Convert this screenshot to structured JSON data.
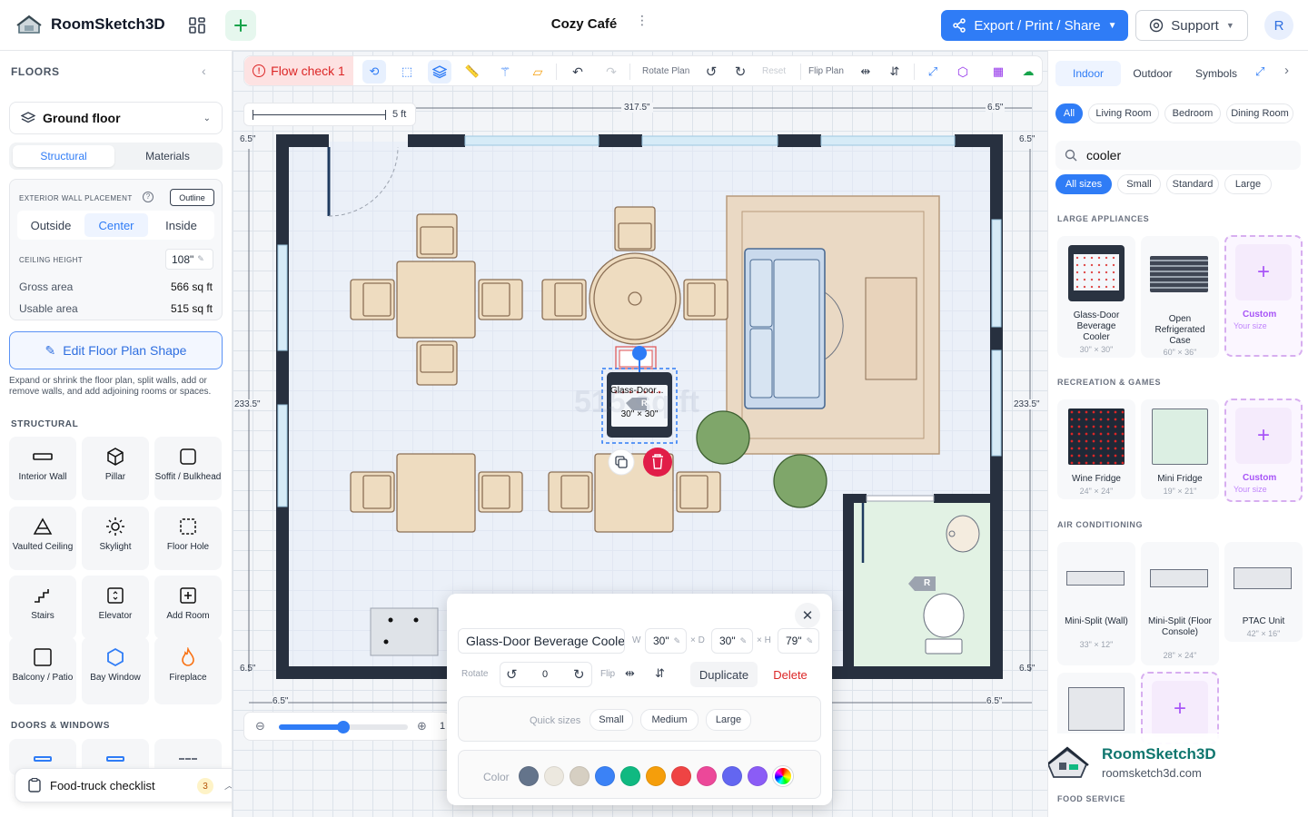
{
  "app": {
    "name": "RoomSketch3D",
    "doc_title": "Cozy Café",
    "export_label": "Export / Print / Share",
    "support_label": "Support",
    "avatar_initial": "R"
  },
  "left": {
    "floors_label": "FLOORS",
    "floor_select": "Ground floor",
    "tabs": [
      "Structural",
      "Materials"
    ],
    "wall_placement_label": "EXTERIOR WALL PLACEMENT",
    "outline_label": "Outline",
    "placement_options": [
      "Outside",
      "Center",
      "Inside"
    ],
    "ceiling_label": "CEILING HEIGHT",
    "ceiling_value": "108\"",
    "gross_label": "Gross area",
    "gross_value": "566 sq ft",
    "usable_label": "Usable area",
    "usable_value": "515 sq ft",
    "edit_btn": "Edit Floor Plan Shape",
    "edit_help": "Expand or shrink the floor plan, split walls, add or remove walls, and add adjoining rooms or spaces.",
    "structural_label": "STRUCTURAL",
    "tiles": [
      {
        "label": "Interior Wall",
        "icon": "interior-wall-icon"
      },
      {
        "label": "Pillar",
        "icon": "pillar-cube-icon"
      },
      {
        "label": "Soffit / Bulkhead",
        "icon": "soffit-icon"
      },
      {
        "label": "Vaulted Ceiling",
        "icon": "vaulted-ceiling-icon"
      },
      {
        "label": "Skylight",
        "icon": "skylight-sun-icon"
      },
      {
        "label": "Floor Hole",
        "icon": "floor-hole-icon"
      },
      {
        "label": "Stairs",
        "icon": "stairs-icon"
      },
      {
        "label": "Elevator",
        "icon": "elevator-icon"
      },
      {
        "label": "Add Room",
        "icon": "add-room-icon"
      },
      {
        "label": "Balcony / Patio",
        "icon": "balcony-icon"
      },
      {
        "label": "Bay Window",
        "icon": "bay-window-icon"
      },
      {
        "label": "Fireplace",
        "icon": "fireplace-icon"
      }
    ],
    "doors_label": "DOORS & WINDOWS",
    "checklist_label": "Food-truck checklist",
    "checklist_count": "3"
  },
  "toolbar": {
    "flow_check": "Flow check 1",
    "rotate_plan": "Rotate Plan",
    "reset": "Reset",
    "flip_plan": "Flip Plan"
  },
  "canvas": {
    "scale_label": "5 ft",
    "dim_top": "317.5\"",
    "dim_top_right": "6.5\"",
    "dim_left_top": "6.5\"",
    "dim_right_top": "6.5\"",
    "dim_left": "233.5\"",
    "dim_right": "233.5\"",
    "dim_left_bottom": "6.5\"",
    "dim_right_bottom": "6.5\"",
    "dim_bottom_left": "6.5\"",
    "dim_bottom_right": "6.5\"",
    "area_watermark": "515 sq ft",
    "selected_label": "Glass-Door...",
    "selected_size": "30\" × 30\"",
    "tag": "R",
    "zoom_value": "1"
  },
  "props": {
    "name": "Glass-Door Beverage Cooler",
    "w_label": "W",
    "w_value": "30\"",
    "d_label": "× D",
    "d_value": "30\"",
    "h_label": "× H",
    "h_value": "79\"",
    "rotate_label": "Rotate",
    "rotate_value": "0",
    "flip_label": "Flip",
    "duplicate": "Duplicate",
    "delete": "Delete",
    "quick_label": "Quick sizes",
    "quick": [
      "Small",
      "Medium",
      "Large"
    ],
    "color_label": "Color",
    "colors": [
      "#64748b",
      "#ece8df",
      "#d6cfc2",
      "#3b82f6",
      "#10b981",
      "#f59e0b",
      "#ef4444",
      "#ec4899",
      "#6366f1",
      "#8b5cf6"
    ]
  },
  "right": {
    "tabs": [
      "Indoor",
      "Outdoor",
      "Symbols"
    ],
    "rooms": [
      "All",
      "Living Room",
      "Bedroom",
      "Dining Room"
    ],
    "search_value": "cooler",
    "sizes": [
      "All sizes",
      "Small",
      "Standard",
      "Large"
    ],
    "large_label": "LARGE APPLIANCES",
    "large": [
      {
        "name": "Glass-Door Beverage Cooler",
        "size": "30\" × 30\""
      },
      {
        "name": "Open Refrigerated Case",
        "size": "60\" × 36\""
      }
    ],
    "custom_label": "Custom",
    "custom_sub": "Your size",
    "rec_label": "RECREATION & GAMES",
    "rec": [
      {
        "name": "Wine Fridge",
        "size": "24\" × 24\""
      },
      {
        "name": "Mini Fridge",
        "size": "19\" × 21\""
      }
    ],
    "ac_label": "AIR CONDITIONING",
    "ac": [
      {
        "name": "Mini-Split (Wall)",
        "size": "33\" × 12\""
      },
      {
        "name": "Mini-Split (Floor Console)",
        "size": "28\" × 24\""
      },
      {
        "name": "PTAC Unit",
        "size": "42\" × 16\""
      }
    ],
    "food_label": "FOOD SERVICE",
    "brand_name": "RoomSketch3D",
    "brand_url": "roomsketch3d.com"
  }
}
